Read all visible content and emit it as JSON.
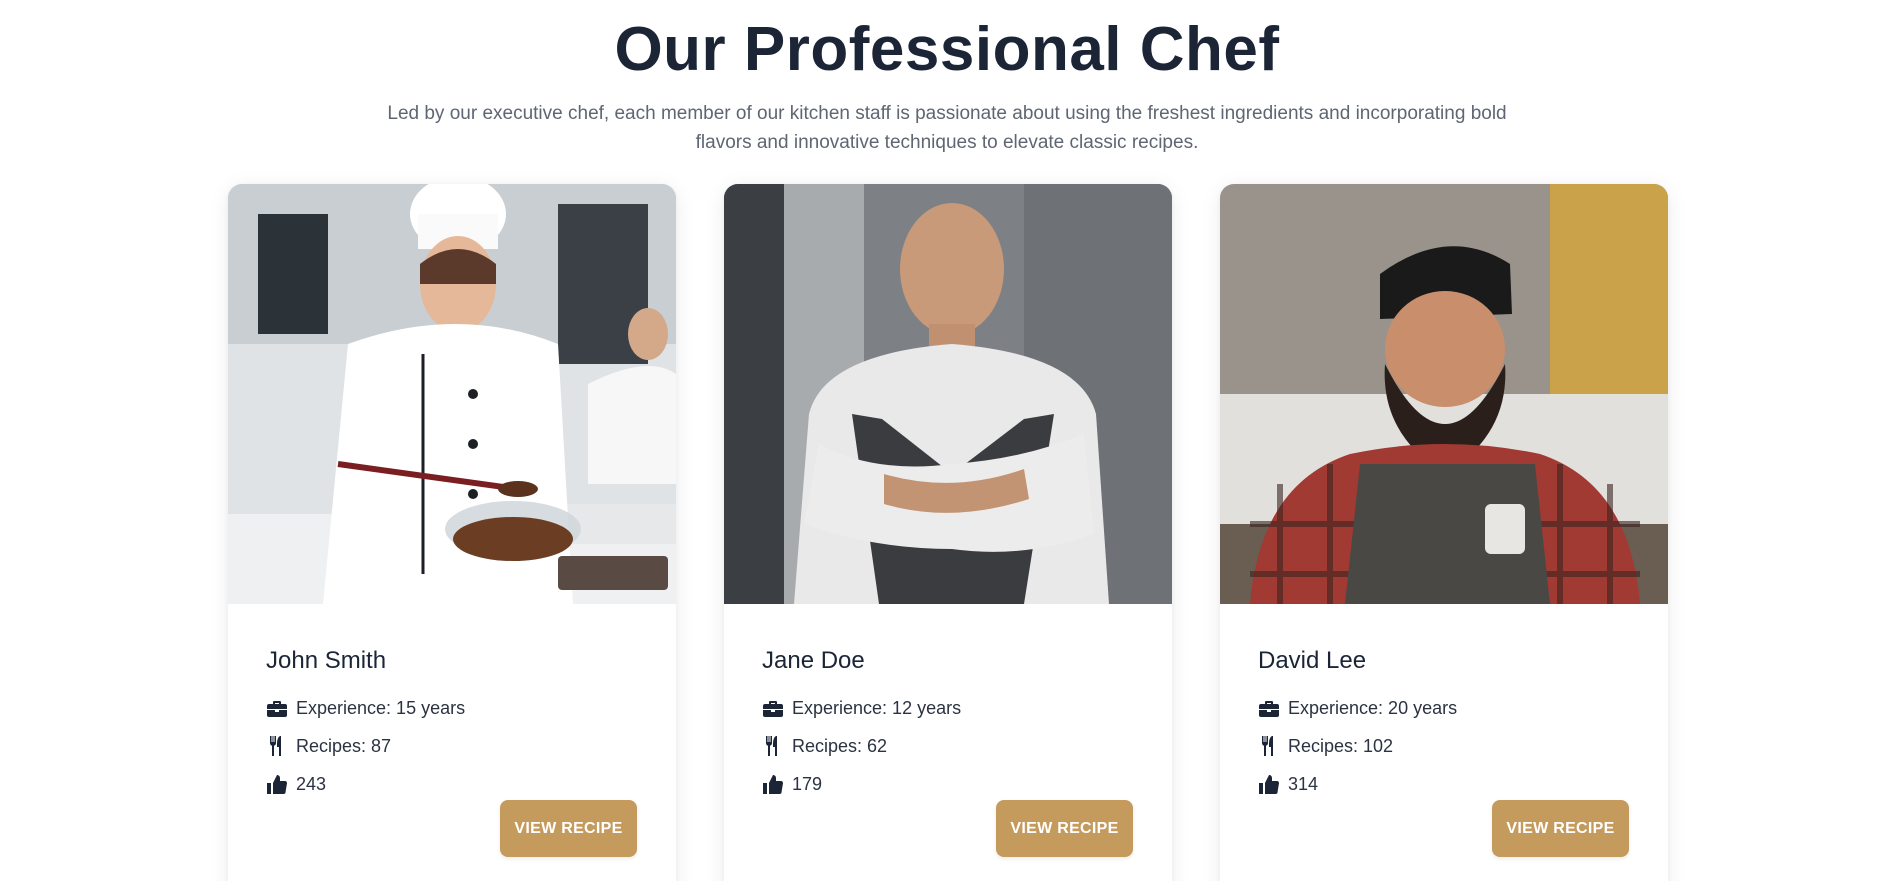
{
  "section": {
    "title": "Our Professional Chef",
    "subtitle": "Led by our executive chef, each member of our kitchen staff is passionate about using the freshest ingredients and incorporating bold flavors and innovative techniques to elevate classic recipes."
  },
  "colors": {
    "heading": "#1b2536",
    "body_text": "#5f6672",
    "button": "#c49a5d",
    "button_text": "#ffffff"
  },
  "icons": {
    "experience": "briefcase-icon",
    "recipes": "utensils-icon",
    "likes": "thumbs-up-icon"
  },
  "chefs": [
    {
      "name": "John Smith",
      "experience": "Experience: 15 years",
      "recipes": "Recipes: 87",
      "likes": "243",
      "button_label": "VIEW RECIPE"
    },
    {
      "name": "Jane Doe",
      "experience": "Experience: 12 years",
      "recipes": "Recipes: 62",
      "likes": "179",
      "button_label": "VIEW RECIPE"
    },
    {
      "name": "David Lee",
      "experience": "Experience: 20 years",
      "recipes": "Recipes: 102",
      "likes": "314",
      "button_label": "VIEW RECIPE"
    }
  ]
}
